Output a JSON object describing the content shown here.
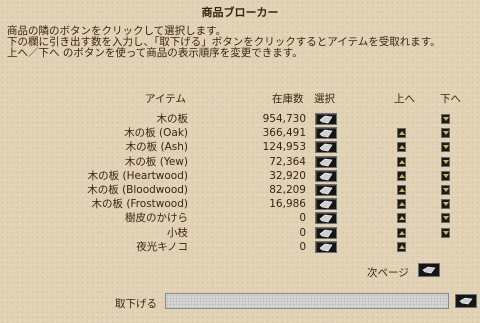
{
  "window": {
    "title": "商品ブローカー"
  },
  "description": [
    "商品の隣のボタンをクリックして選択します。",
    "下の欄に引き出す数を入力し、「取下げる」ボタンをクリックするとアイテムを受取れます。",
    "上へ／下へ のボタンを使って商品の表示順序を変更できます。"
  ],
  "headers": {
    "item": "アイテム",
    "stock": "在庫数",
    "select": "選択",
    "up": "上へ",
    "down": "下へ"
  },
  "items": [
    {
      "name": "木の板",
      "qty": "954,730",
      "up": false,
      "down": true
    },
    {
      "name": "木の板 (Oak)",
      "qty": "366,491",
      "up": true,
      "down": true
    },
    {
      "name": "木の板 (Ash)",
      "qty": "124,953",
      "up": true,
      "down": true
    },
    {
      "name": "木の板 (Yew)",
      "qty": "72,364",
      "up": true,
      "down": true
    },
    {
      "name": "木の板 (Heartwood)",
      "qty": "32,920",
      "up": true,
      "down": true
    },
    {
      "name": "木の板 (Bloodwood)",
      "qty": "82,209",
      "up": true,
      "down": true
    },
    {
      "name": "木の板 (Frostwood)",
      "qty": "16,986",
      "up": true,
      "down": true
    },
    {
      "name": "樹皮のかけら",
      "qty": "0",
      "up": true,
      "down": true
    },
    {
      "name": "小枝",
      "qty": "0",
      "up": true,
      "down": true
    },
    {
      "name": "夜光キノコ",
      "qty": "0",
      "up": true,
      "down": false
    }
  ],
  "pager": {
    "next_label": "次ページ"
  },
  "withdraw": {
    "label": "取下げる",
    "value": ""
  }
}
